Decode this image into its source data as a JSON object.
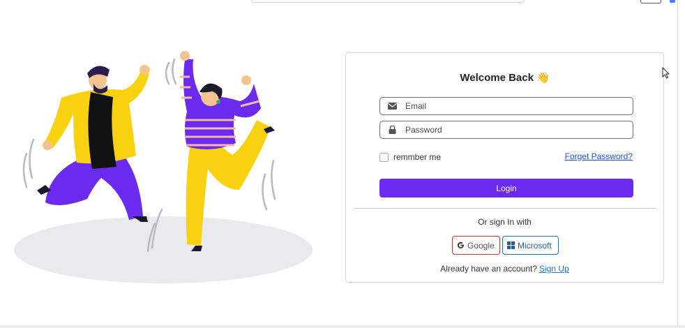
{
  "login": {
    "title": "Welcome Back",
    "title_emoji": "👋",
    "email_placeholder": "Email",
    "password_placeholder": "Password",
    "remember_label": "remmber me",
    "forgot_link": "Forget Password?",
    "login_button": "Login",
    "divider_text": "Or sign In with",
    "google_button": "Google",
    "microsoft_button": "Microsoft",
    "account_prompt": "Already have an account?",
    "signup_link": "Sign Up"
  },
  "icons": {
    "email": "envelope-icon",
    "password": "lock-icon",
    "google": "google-icon",
    "microsoft": "microsoft-icon"
  },
  "colors": {
    "accent": "#6b2bef",
    "google_border": "#c0392b",
    "microsoft_border": "#2a6ea8",
    "link": "#1d74d8"
  }
}
